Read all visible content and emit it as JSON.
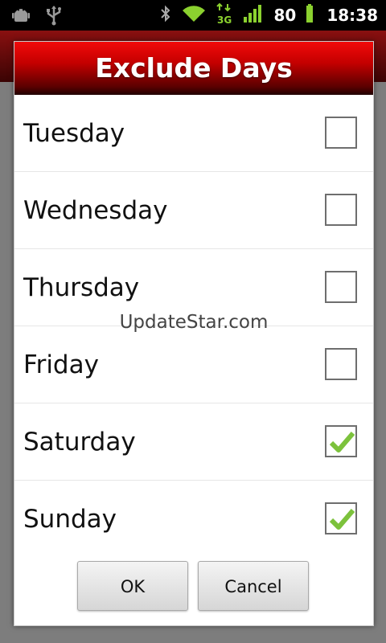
{
  "status_bar": {
    "battery": "80",
    "time": "18:38",
    "network_type": "3G",
    "icons": [
      "android-debug-icon",
      "usb-icon",
      "bluetooth-icon",
      "wifi-icon",
      "data-3g-icon",
      "signal-icon",
      "battery-icon"
    ]
  },
  "dialog": {
    "title": "Exclude Days",
    "days": [
      {
        "label": "Tuesday",
        "checked": false
      },
      {
        "label": "Wednesday",
        "checked": false
      },
      {
        "label": "Thursday",
        "checked": false
      },
      {
        "label": "Friday",
        "checked": false
      },
      {
        "label": "Saturday",
        "checked": true
      },
      {
        "label": "Sunday",
        "checked": true
      }
    ],
    "ok_label": "OK",
    "cancel_label": "Cancel"
  },
  "watermark": "UpdateStar.com",
  "colors": {
    "title_red": "#e00000",
    "check_green": "#7cc23c",
    "status_green": "#8bd12f"
  }
}
